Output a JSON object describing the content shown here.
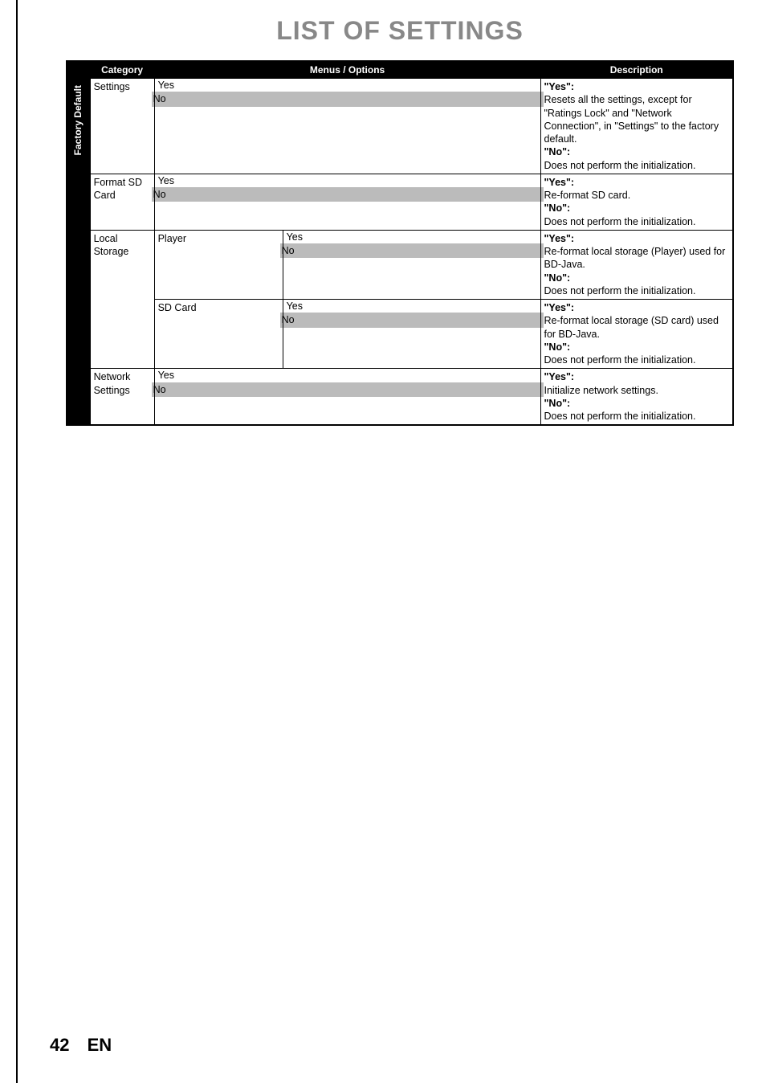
{
  "title": "LIST OF SETTINGS",
  "headers": {
    "category": "Category",
    "menus": "Menus / Options",
    "description": "Description"
  },
  "sideTab": "Factory Default",
  "rows": {
    "settings": {
      "label": "Settings",
      "optYes": "Yes",
      "optNo": "No",
      "desc": {
        "yesLabel": "\"Yes\":",
        "yesText": "Resets all the settings, except for \"Ratings Lock\" and \"Network Connection\", in \"Settings\" to the factory default.",
        "noLabel": "\"No\":",
        "noText": "Does not perform the initialization."
      }
    },
    "formatSD": {
      "label": "Format SD Card",
      "optYes": "Yes",
      "optNo": "No",
      "desc": {
        "yesLabel": "\"Yes\":",
        "yesText": "Re-format SD card.",
        "noLabel": "\"No\":",
        "noText": "Does not perform the initialization."
      }
    },
    "localStorage": {
      "label": "Local Storage",
      "player": {
        "label": "Player",
        "optYes": "Yes",
        "optNo": "No",
        "desc": {
          "yesLabel": "\"Yes\":",
          "yesText": "Re-format local storage (Player) used for BD-Java.",
          "noLabel": "\"No\":",
          "noText": "Does not perform the initialization."
        }
      },
      "sdcard": {
        "label": "SD Card",
        "optYes": "Yes",
        "optNo": "No",
        "desc": {
          "yesLabel": "\"Yes\":",
          "yesText": "Re-format local storage (SD card) used for BD-Java.",
          "noLabel": "\"No\":",
          "noText": "Does not perform the initialization."
        }
      }
    },
    "network": {
      "label": "Network Settings",
      "optYes": "Yes",
      "optNo": "No",
      "desc": {
        "yesLabel": "\"Yes\":",
        "yesText": "Initialize network settings.",
        "noLabel": "\"No\":",
        "noText": "Does not perform the initialization."
      }
    }
  },
  "footer": {
    "page": "42",
    "lang": "EN"
  }
}
